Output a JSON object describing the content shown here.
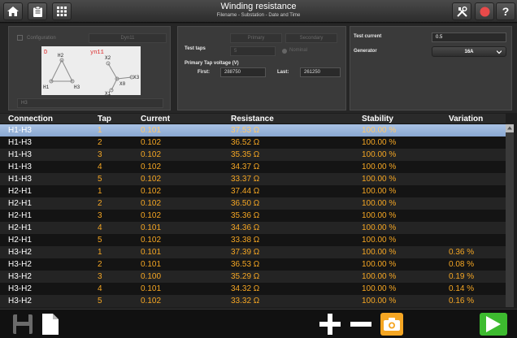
{
  "header": {
    "title": "Winding resistance",
    "subtitle": "Filename - Substation - Date and Time",
    "icons": [
      "home-icon",
      "clipboard-icon",
      "grid-icon",
      "tools-icon",
      "record-icon",
      "help-icon"
    ],
    "help_label": "?"
  },
  "config": {
    "configuration_label": "Configuration",
    "vector_group_tab": "Dyn11",
    "field_value": "H3",
    "diagram": {
      "primary_label": "D",
      "secondary_label": "yn11",
      "primary_terminals": [
        "H2",
        "H1",
        "H3"
      ],
      "secondary_terminals": [
        "X2",
        "X3",
        "X0",
        "X1"
      ]
    }
  },
  "taps": {
    "tab_primary": "Primary",
    "tab_secondary": "Secondary",
    "test_taps_label": "Test taps",
    "test_taps_value": "5",
    "nominal_label": "Nominal",
    "primary_tap_voltage_label": "Primary Tap voltage (V)",
    "first_label": "First:",
    "first_value": "288750",
    "last_label": "Last:",
    "last_value": "261250"
  },
  "settings": {
    "test_current_label": "Test current",
    "test_current_value": "0.5",
    "generator_label": "Generator",
    "generator_value": "16A"
  },
  "table": {
    "headers": [
      "Connection",
      "Tap",
      "Current",
      "Resistance",
      "Stability",
      "Variation"
    ],
    "rows": [
      [
        "H1-H3",
        "1",
        "0.101",
        "37.53 Ω",
        "100.00 %",
        ""
      ],
      [
        "H1-H3",
        "2",
        "0.102",
        "36.52 Ω",
        "100.00 %",
        ""
      ],
      [
        "H1-H3",
        "3",
        "0.102",
        "35.35 Ω",
        "100.00 %",
        ""
      ],
      [
        "H1-H3",
        "4",
        "0.102",
        "34.37 Ω",
        "100.00 %",
        ""
      ],
      [
        "H1-H3",
        "5",
        "0.102",
        "33.37 Ω",
        "100.00 %",
        ""
      ],
      [
        "H2-H1",
        "1",
        "0.102",
        "37.44 Ω",
        "100.00 %",
        ""
      ],
      [
        "H2-H1",
        "2",
        "0.102",
        "36.50 Ω",
        "100.00 %",
        ""
      ],
      [
        "H2-H1",
        "3",
        "0.102",
        "35.36 Ω",
        "100.00 %",
        ""
      ],
      [
        "H2-H1",
        "4",
        "0.101",
        "34.36 Ω",
        "100.00 %",
        ""
      ],
      [
        "H2-H1",
        "5",
        "0.102",
        "33.38 Ω",
        "100.00 %",
        ""
      ],
      [
        "H3-H2",
        "1",
        "0.101",
        "37.39 Ω",
        "100.00 %",
        "0.36 %"
      ],
      [
        "H3-H2",
        "2",
        "0.101",
        "36.53 Ω",
        "100.00 %",
        "0.08 %"
      ],
      [
        "H3-H2",
        "3",
        "0.100",
        "35.29 Ω",
        "100.00 %",
        "0.19 %"
      ],
      [
        "H3-H2",
        "4",
        "0.101",
        "34.32 Ω",
        "100.00 %",
        "0.14 %"
      ],
      [
        "H3-H2",
        "5",
        "0.102",
        "33.32 Ω",
        "100.00 %",
        "0.16 %"
      ]
    ],
    "selected_row": 0
  },
  "footer": {
    "icons": [
      "save-icon",
      "document-icon",
      "add-icon",
      "remove-icon",
      "camera-icon",
      "play-icon"
    ]
  },
  "colors": {
    "accent_orange": "#f5a623",
    "selection_blue": "#9ab6dd",
    "play_green": "#3dbb2f"
  }
}
